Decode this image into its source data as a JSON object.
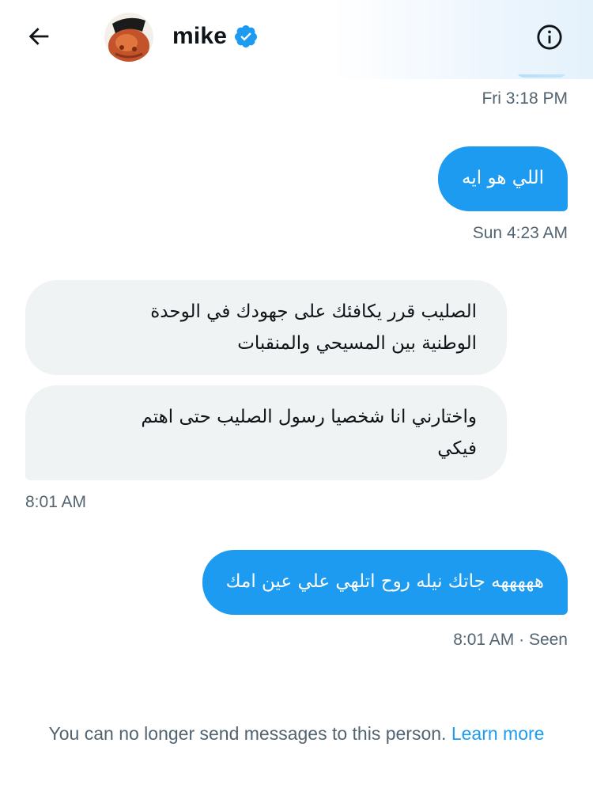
{
  "header": {
    "back_icon": "arrow-left-icon",
    "name": "mike",
    "verified_icon": "verified-badge-icon",
    "info_icon": "info-icon",
    "colors": {
      "verified": "#1d9bf0"
    }
  },
  "messages": [
    {
      "direction": "outgoing",
      "lines": [
        "اللي هو ايه"
      ]
    },
    {
      "direction": "incoming",
      "lines": [
        "الصليب قرر يكافئك على جهودك في الوحدة",
        "الوطنية بين المسيحي والمنقبات"
      ]
    },
    {
      "direction": "incoming",
      "lines": [
        "واختارني انا شخصيا  رسول الصليب حتى اهتم",
        "فيكي"
      ]
    },
    {
      "direction": "outgoing",
      "lines": [
        "هههههه جاتك نيله روح اتلهي علي عين امك"
      ]
    }
  ],
  "timestamps": {
    "t1": "Fri 3:18 PM",
    "t2": "Sun 4:23 AM",
    "t3": "8:01 AM",
    "t4": "8:01 AM · Seen"
  },
  "footer": {
    "text": "You can no longer send messages to this person.",
    "link": "Learn more"
  },
  "colors": {
    "accent": "#1d9bf0",
    "incoming_bubble": "#eff3f4",
    "secondary_text": "#536471",
    "primary_text": "#0f1419"
  }
}
